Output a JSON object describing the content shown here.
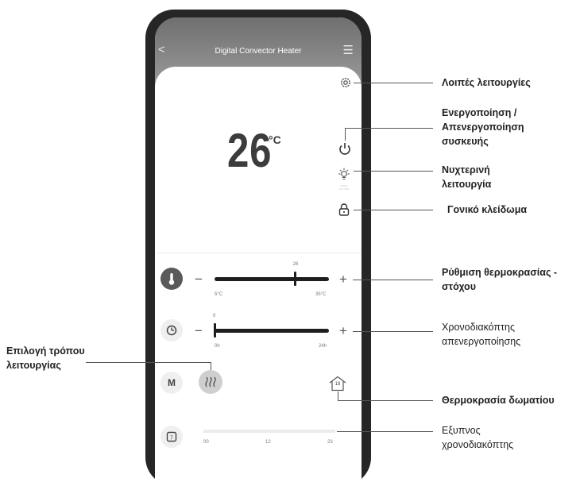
{
  "app": {
    "title": "Digital Convector Heater",
    "back_glyph": "<",
    "menu_glyph": "☰"
  },
  "main": {
    "temperature": "26",
    "unit": "°C",
    "light_label_line1": "LIGHT",
    "light_label_line2": "ON / OFF"
  },
  "target_slider": {
    "value": "26",
    "min_label": "5°C",
    "max_label": "35°C",
    "value_fraction": 0.7,
    "minus": "−",
    "plus": "+"
  },
  "timer_slider": {
    "value": "0",
    "min_label": "0h",
    "max_label": "24h",
    "value_fraction": 0.0,
    "minus": "−",
    "plus": "+"
  },
  "mode": {
    "label": "M"
  },
  "room": {
    "value": "18"
  },
  "schedule": {
    "ticks": [
      "00",
      "12",
      "23"
    ]
  },
  "annotations": {
    "more_functions": "Λοιπές λειτουργίες",
    "power_line1": "Ενεργοποίηση /",
    "power_line2": "Απενεργοποίηση",
    "power_line3": "συσκευής",
    "night_line1": "Νυχτερινή",
    "night_line2": "λειτουργία",
    "parental_lock": "Γονικό κλείδωμα",
    "target_line1": "Ρύθμιση θερμοκρασίας -",
    "target_line2": "στόχου",
    "timer_line1": "Χρονοδιακόπτης",
    "timer_line2": "απενεργοποίησης",
    "mode_line1": "Επιλογή τρόπου",
    "mode_line2": "λειτουργίας",
    "room_temp": "Θερμοκρασία δωματίου",
    "smart_line1": "Εξυπνος",
    "smart_line2": "χρονοδιακόπτης"
  },
  "colors": {
    "phone_frame": "#262626",
    "header": "#8a8a8a",
    "accent_dark": "#1e1e1e"
  }
}
